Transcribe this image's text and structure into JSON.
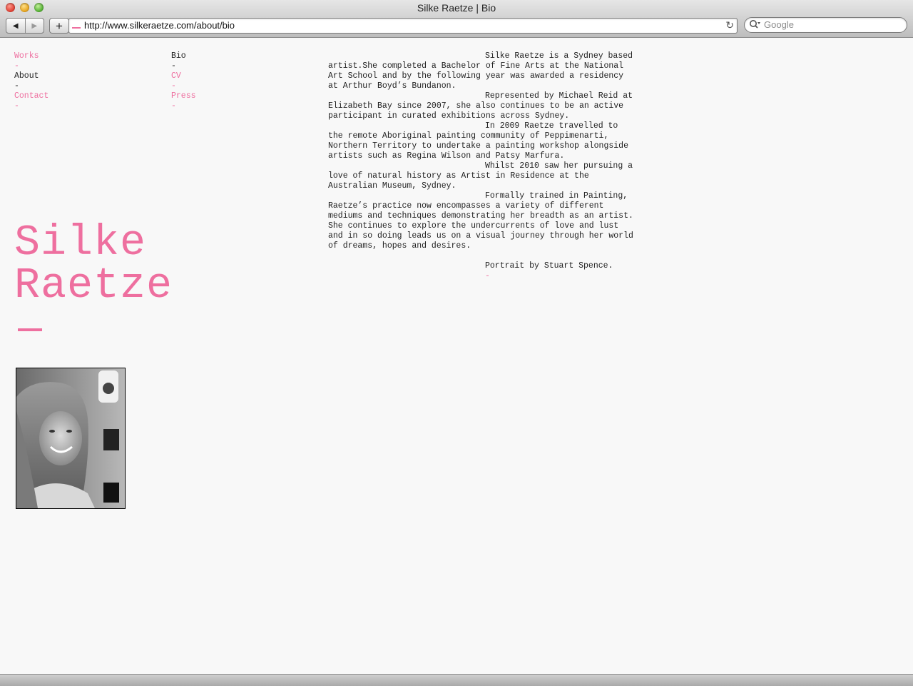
{
  "window": {
    "title": "Silke Raetze | Bio"
  },
  "toolbar": {
    "back_glyph": "◀",
    "forward_glyph": "▶",
    "add_glyph": "+",
    "url": "http://www.silkeraetze.com/about/bio",
    "reload_glyph": "↻",
    "search_placeholder": "Google"
  },
  "nav": {
    "primary": [
      {
        "label": "Works",
        "dash": "-"
      },
      {
        "label": "About",
        "dash": "-"
      },
      {
        "label": "Contact",
        "dash": "-"
      }
    ],
    "secondary": [
      {
        "label": "Bio",
        "dash": "-"
      },
      {
        "label": "CV",
        "dash": "-"
      },
      {
        "label": "Press",
        "dash": "-"
      }
    ]
  },
  "artist": {
    "first_name": "Silke",
    "last_name": "Raetze"
  },
  "bio": {
    "paragraphs": [
      "Silke Raetze is a Sydney based artist.She completed a Bachelor of Fine Arts at the National Art School and by the following year was awarded a residency at Arthur Boyd’s Bundanon.",
      "Represented by Michael Reid at Elizabeth Bay since 2007, she also continues to be an active participant in curated exhibitions across Sydney.",
      "In 2009 Raetze travelled to the remote Aboriginal painting community of Peppimenarti, Northern Territory to undertake a painting workshop alongside artists such as Regina Wilson and Patsy Marfura.",
      "Whilst 2010 saw her pursuing a love of natural history as Artist in Residence at the Australian Museum, Sydney.",
      "Formally trained in Painting, Raetze’s practice now encompasses a variety of different mediums and techniques demonstrating her breadth as an artist. She continues to explore the undercurrents of love and lust and in so doing leads us on a visual journey through her world of dreams, hopes and desires."
    ],
    "credit": "Portrait by Stuart Spence.",
    "credit_dash": "-"
  },
  "colors": {
    "accent": "#ee6f9f",
    "text": "#222222",
    "background": "#f8f8f8"
  }
}
